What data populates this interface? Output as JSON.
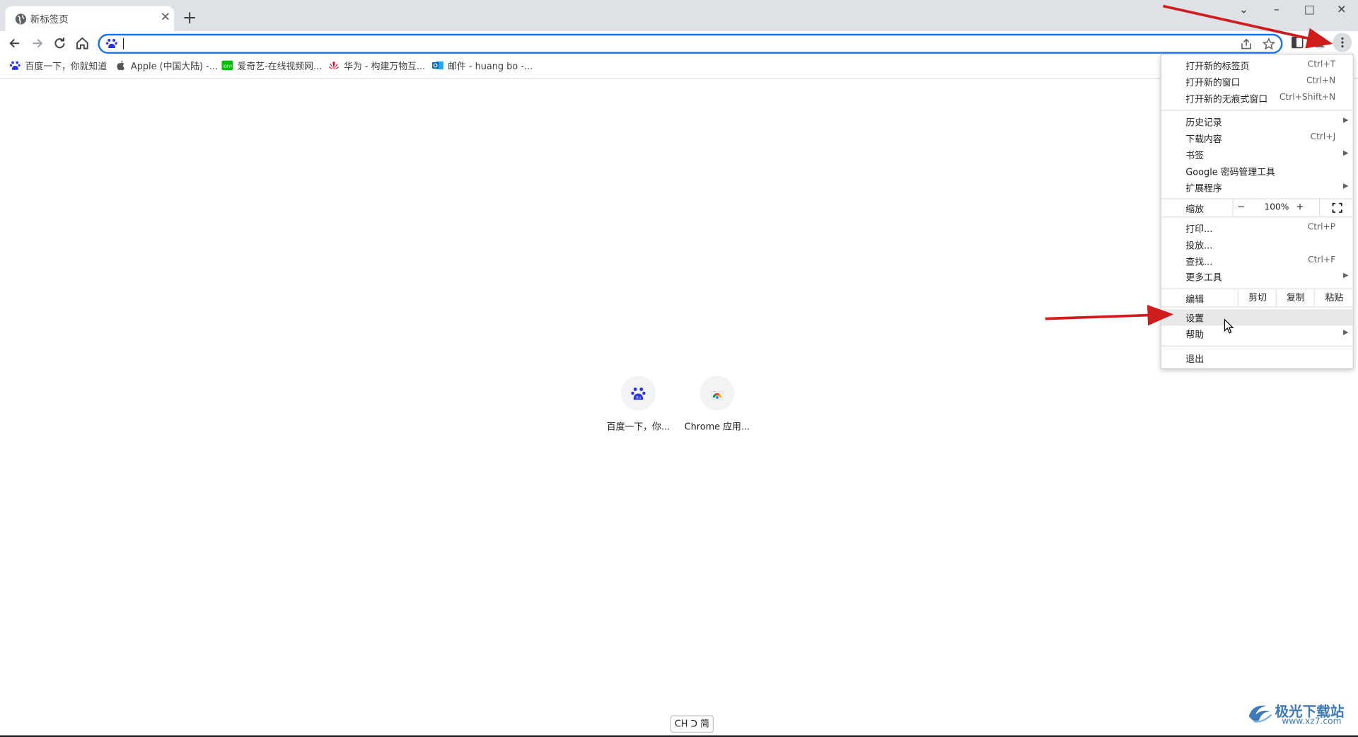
{
  "window": {
    "tab_title": "新标签页",
    "controls": {
      "dropdown": "⌄",
      "minimize": "–",
      "maximize": "□",
      "close": "✕"
    }
  },
  "toolbar": {
    "omnibox_value": "",
    "icons": [
      "back-icon",
      "forward-icon",
      "reload-icon",
      "home-icon",
      "share-icon",
      "star-icon",
      "side-panel-icon",
      "profile-icon",
      "more-vert-icon"
    ]
  },
  "bookmarks": [
    {
      "label": "百度一下，你就知道",
      "icon": "baidu-icon"
    },
    {
      "label": "Apple (中国大陆) -...",
      "icon": "apple-icon"
    },
    {
      "label": "爱奇艺-在线视频网...",
      "icon": "iqiyi-icon"
    },
    {
      "label": "华为 - 构建万物互...",
      "icon": "huawei-icon"
    },
    {
      "label": "邮件 - huang bo -...",
      "icon": "outlook-icon"
    }
  ],
  "shortcuts": [
    {
      "label": "百度一下，你...",
      "icon": "baidu-icon"
    },
    {
      "label": "Chrome 应用...",
      "icon": "chrome-webstore-icon"
    }
  ],
  "menu": {
    "group1": [
      {
        "label": "打开新的标签页",
        "shortcut": "Ctrl+T"
      },
      {
        "label": "打开新的窗口",
        "shortcut": "Ctrl+N"
      },
      {
        "label": "打开新的无痕式窗口",
        "shortcut": "Ctrl+Shift+N"
      }
    ],
    "group2": [
      {
        "label": "历史记录",
        "submenu": true
      },
      {
        "label": "下载内容",
        "shortcut": "Ctrl+J"
      },
      {
        "label": "书签",
        "submenu": true
      },
      {
        "label": "Google 密码管理工具"
      },
      {
        "label": "扩展程序",
        "submenu": true
      }
    ],
    "zoom": {
      "label": "缩放",
      "minus": "−",
      "value": "100%",
      "plus": "+"
    },
    "group3": [
      {
        "label": "打印...",
        "shortcut": "Ctrl+P"
      },
      {
        "label": "投放..."
      },
      {
        "label": "查找...",
        "shortcut": "Ctrl+F"
      },
      {
        "label": "更多工具",
        "submenu": true
      }
    ],
    "edit": {
      "label": "编辑",
      "cut": "剪切",
      "copy": "复制",
      "paste": "粘贴"
    },
    "group4": [
      {
        "label": "设置",
        "highlighted": true
      },
      {
        "label": "帮助",
        "submenu": true
      }
    ],
    "exit": {
      "label": "退出"
    }
  },
  "taskbar": {
    "ime": "CH ᑐ 简"
  },
  "watermark": {
    "text": "极光下载站",
    "url": "www.xz7.com"
  },
  "colors": {
    "accent": "#1a73e8",
    "arrow": "#d01c1c",
    "tabstrip": "#dee1e6"
  }
}
